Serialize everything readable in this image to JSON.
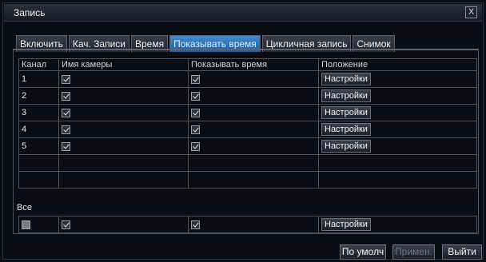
{
  "window": {
    "title": "Запись",
    "close_glyph": "X"
  },
  "tabs": [
    {
      "label": "Включить",
      "active": false
    },
    {
      "label": "Кач. Записи",
      "active": false
    },
    {
      "label": "Время",
      "active": false
    },
    {
      "label": "Показывать время",
      "active": true
    },
    {
      "label": "Цикличная запись",
      "active": false
    },
    {
      "label": "Снимок",
      "active": false
    }
  ],
  "table": {
    "headers": {
      "channel": "Канал",
      "camera_name": "Имя камеры",
      "show_time": "Показывать время",
      "position": "Положение"
    },
    "rows": [
      {
        "channel": "1",
        "camera_name": true,
        "show_time": true,
        "position_button": "Настройки"
      },
      {
        "channel": "2",
        "camera_name": true,
        "show_time": true,
        "position_button": "Настройки"
      },
      {
        "channel": "3",
        "camera_name": true,
        "show_time": true,
        "position_button": "Настройки"
      },
      {
        "channel": "4",
        "camera_name": true,
        "show_time": true,
        "position_button": "Настройки"
      },
      {
        "channel": "5",
        "camera_name": true,
        "show_time": true,
        "position_button": "Настройки"
      }
    ]
  },
  "all": {
    "label": "Все",
    "position_button": "Настройки"
  },
  "footer": {
    "default_label": "По умолч",
    "apply_label": "Примен.",
    "exit_label": "Выйти"
  }
}
